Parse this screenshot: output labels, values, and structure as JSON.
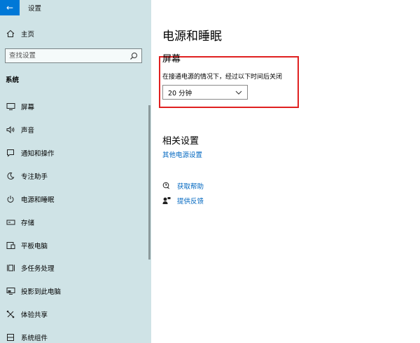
{
  "window": {
    "title": "设置"
  },
  "sidebar": {
    "home_label": "主页",
    "search_placeholder": "查找设置",
    "section_title": "系统",
    "items": [
      {
        "label": "屏幕",
        "icon": "monitor-icon"
      },
      {
        "label": "声音",
        "icon": "speaker-icon"
      },
      {
        "label": "通知和操作",
        "icon": "notification-icon"
      },
      {
        "label": "专注助手",
        "icon": "moon-icon"
      },
      {
        "label": "电源和睡眠",
        "icon": "power-icon"
      },
      {
        "label": "存储",
        "icon": "storage-icon"
      },
      {
        "label": "平板电脑",
        "icon": "tablet-icon"
      },
      {
        "label": "多任务处理",
        "icon": "multitask-icon"
      },
      {
        "label": "投影到此电脑",
        "icon": "project-icon"
      },
      {
        "label": "体验共享",
        "icon": "share-icon"
      },
      {
        "label": "系统组件",
        "icon": "components-icon"
      }
    ]
  },
  "main": {
    "page_title": "电源和睡眠",
    "screen_section": {
      "title": "屏幕",
      "description": "在接通电源的情况下，经过以下时间后关闭",
      "dropdown_value": "20 分钟"
    },
    "related": {
      "title": "相关设置",
      "link": "其他电源设置"
    },
    "help": [
      {
        "label": "获取帮助",
        "icon": "help-chat-icon"
      },
      {
        "label": "提供反馈",
        "icon": "feedback-icon"
      }
    ]
  },
  "colors": {
    "sidebar_bg": "#cfe3e6",
    "accent": "#0078d7",
    "link": "#0067c0",
    "highlight_border": "#e02020"
  }
}
